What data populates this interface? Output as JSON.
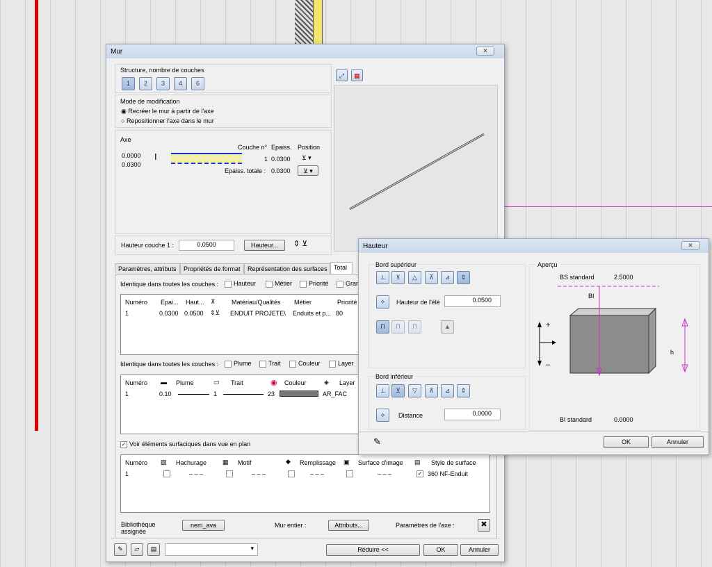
{
  "mur": {
    "title": "Mur",
    "structure_label": "Structure, nombre de couches",
    "layer_buttons": [
      "1",
      "2",
      "3",
      "4",
      "6"
    ],
    "mode_label": "Mode de modification",
    "mode_options": [
      "Recréer le mur à partir de l'axe",
      "Repositionner l'axe dans le mur"
    ],
    "axe_label": "Axe",
    "axe_values": [
      "0.0000",
      "0.0300"
    ],
    "couche_no_label": "Couche n°",
    "epaiss_label": "Epaiss.",
    "position_label": "Position",
    "couche_row": {
      "no": "1",
      "epaiss": "0.0300"
    },
    "epaiss_totale_label": "Epaiss. totale :",
    "epaiss_totale_value": "0.0300",
    "hauteur_couche_label": "Hauteur couche 1 :",
    "hauteur_couche_value": "0.0500",
    "hauteur_button": "Hauteur...",
    "tabs": [
      "Paramètres, attributs",
      "Propriétés de format",
      "Représentation des surfaces",
      "Total"
    ],
    "identique1_label": "Identique dans toutes les couches :",
    "identique1_options": [
      "Hauteur",
      "Métier",
      "Priorité",
      "Gran"
    ],
    "table1_headers": [
      "Numéro",
      "Epai...",
      "Haut...",
      "",
      "Matériau/Qualités",
      "Métier",
      "Priorité"
    ],
    "table1_row": [
      "1",
      "0.0300",
      "0.0500",
      "",
      "ENDUIT PROJETE\\",
      "Enduits et p...",
      "80"
    ],
    "identique2_label": "Identique dans toutes les couches :",
    "identique2_options": [
      "Plume",
      "Trait",
      "Couleur",
      "Layer"
    ],
    "table2_headers": [
      "Numéro",
      "Plume",
      "Trait",
      "Couleur",
      "Layer"
    ],
    "table2_row": {
      "no": "1",
      "plume": "0.10",
      "trait": "1",
      "couleur": "23",
      "layer": "AR_FAC"
    },
    "voir_label": "Voir éléments surfaciques dans vue en plan",
    "table3_headers": [
      "Numéro",
      "Hachurage",
      "Motif",
      "Remplissage",
      "Surface d'image",
      "Style de surface"
    ],
    "table3_row": {
      "no": "1",
      "dash": "– – –",
      "style": "360 NF-Enduit"
    },
    "biblio_label": "Bibliothèque assignée",
    "biblio_button": "nem_ava",
    "mur_entier_label": "Mur entier :",
    "attributs_button": "Attributs...",
    "params_axe_label": "Paramètres de l'axe :",
    "reduire_button": "Réduire <<",
    "ok_button": "OK",
    "annuler_button": "Annuler"
  },
  "hauteur": {
    "title": "Hauteur",
    "bord_superieur": "Bord supérieur",
    "hauteur_elem_label": "Hauteur de l'élé",
    "hauteur_elem_value": "0.0500",
    "bord_inferieur": "Bord inférieur",
    "distance_label": "Distance",
    "distance_value": "0.0000",
    "apercu_label": "Aperçu",
    "bs_standard_label": "BS standard",
    "bs_standard_value": "2.5000",
    "bi_label": "BI",
    "h_label": "h",
    "plus_label": "+",
    "minus_label": "–",
    "bi_standard_label": "BI standard",
    "bi_standard_value": "0.0000",
    "ok_button": "OK",
    "annuler_button": "Annuler"
  },
  "colors": {
    "accent_red": "#e00000",
    "magenta": "#cc33cc",
    "highlight": "#f4f0a8"
  }
}
